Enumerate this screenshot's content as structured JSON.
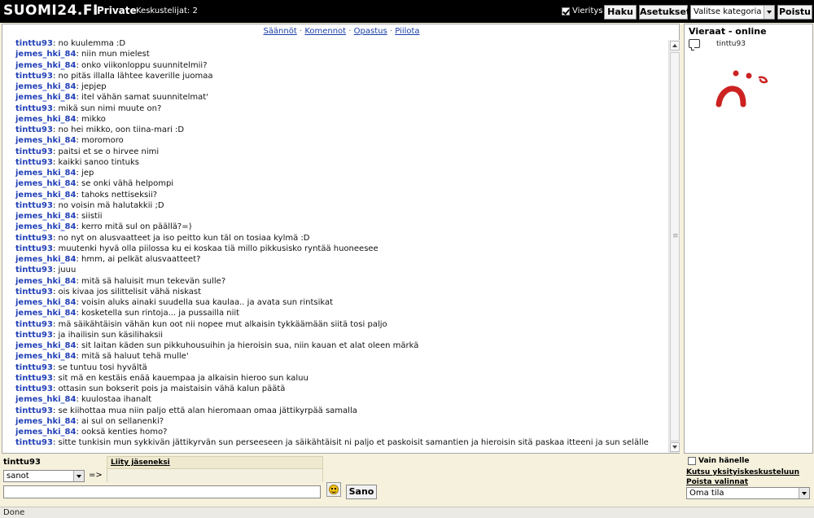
{
  "header": {
    "logo": "SUOMI24.FI",
    "room": "Private",
    "users_label": "Keskustelijat: 2",
    "scroll_label": "Vieritys",
    "search_btn": "Haku",
    "settings_btn": "Asetukset",
    "category_select": "Valitse kategoria",
    "leave_btn": "Poistu"
  },
  "chat_links": {
    "rules": "Säännöt",
    "commands": "Komennot",
    "help": "Opastus",
    "hide": "Piilota"
  },
  "messages": [
    {
      "nick": "tinttu93",
      "text": "no kuulemma :D"
    },
    {
      "nick": "jemes_hki_84",
      "text": "niin mun mielest"
    },
    {
      "nick": "jemes_hki_84",
      "text": "onko viikonloppu suunnitelmii?"
    },
    {
      "nick": "tinttu93",
      "text": "no pitäs illalla lähtee kaverille juomaa"
    },
    {
      "nick": "jemes_hki_84",
      "text": "jepjep"
    },
    {
      "nick": "jemes_hki_84",
      "text": "itel vähän samat suunnitelmat'"
    },
    {
      "nick": "tinttu93",
      "text": "mikä sun nimi muute on?"
    },
    {
      "nick": "jemes_hki_84",
      "text": "mikko"
    },
    {
      "nick": "tinttu93",
      "text": "no hei mikko, oon tiina-mari :D"
    },
    {
      "nick": "jemes_hki_84",
      "text": "moromoro"
    },
    {
      "nick": "tinttu93",
      "text": "paitsi et se o hirvee nimi"
    },
    {
      "nick": "tinttu93",
      "text": "kaikki sanoo tintuks"
    },
    {
      "nick": "jemes_hki_84",
      "text": "jep"
    },
    {
      "nick": "jemes_hki_84",
      "text": "se onki vähä helpompi"
    },
    {
      "nick": "jemes_hki_84",
      "text": "tahoks nettiseksii?"
    },
    {
      "nick": "tinttu93",
      "text": "no voisin mä halutakkii ;D"
    },
    {
      "nick": "jemes_hki_84",
      "text": "siistii"
    },
    {
      "nick": "jemes_hki_84",
      "text": "kerro mitä sul on päällä?=)"
    },
    {
      "nick": "tinttu93",
      "text": "no nyt on alusvaatteet ja iso peitto kun täl on tosiaa kylmä :D"
    },
    {
      "nick": "tinttu93",
      "text": "muutenki hyvä olla piilossa ku ei koskaa tiä millo pikkusisko ryntää huoneesee"
    },
    {
      "nick": "jemes_hki_84",
      "text": "hmm, ai pelkät alusvaatteet?"
    },
    {
      "nick": "tinttu93",
      "text": "juuu"
    },
    {
      "nick": "jemes_hki_84",
      "text": "mitä sä haluisit mun tekevän sulle?"
    },
    {
      "nick": "tinttu93",
      "text": "ois kivaa jos silittelisit vähä niskast"
    },
    {
      "nick": "jemes_hki_84",
      "text": "voisin aluks ainaki suudella sua kaulaa.. ja avata sun rintsikat"
    },
    {
      "nick": "jemes_hki_84",
      "text": "kosketella sun rintoja... ja pussailla niit"
    },
    {
      "nick": "tinttu93",
      "text": "mä säikähtäisin vähän kun oot nii nopee mut alkaisin tykkäämään siitä tosi paljo"
    },
    {
      "nick": "tinttu93",
      "text": "ja ihailisin sun käsilihaksii"
    },
    {
      "nick": "jemes_hki_84",
      "text": "sit laitan käden sun pikkuhousuihin ja hieroisin sua, niin kauan et alat oleen märkä"
    },
    {
      "nick": "jemes_hki_84",
      "text": "mitä sä haluut tehä mulle'"
    },
    {
      "nick": "tinttu93",
      "text": "se tuntuu tosi hyvältä"
    },
    {
      "nick": "tinttu93",
      "text": "sit mä en kestäis enää kauempaa ja alkaisin hieroo sun kaluu"
    },
    {
      "nick": "tinttu93",
      "text": "ottasin sun bokserit pois ja maistaisin vähä kalun päätä"
    },
    {
      "nick": "jemes_hki_84",
      "text": "kuulostaa ihanalt"
    },
    {
      "nick": "tinttu93",
      "text": "se kiihottaa mua niin paljo että alan hieromaan omaa jättikyrpää samalla"
    },
    {
      "nick": "jemes_hki_84",
      "text": "ai sul on sellanenki?"
    },
    {
      "nick": "jemes_hki_84",
      "text": "ooksä kenties homo?"
    },
    {
      "nick": "tinttu93",
      "text": "sitte tunkisin mun sykkivän jättikyrvän sun perseeseen ja säikähtäisit ni paljo et paskoisit samantien ja hieroisin sitä paskaa itteeni ja sun selälle"
    }
  ],
  "users_panel": {
    "title": "Vieraat - online",
    "users": [
      "tinttu93"
    ]
  },
  "input_area": {
    "my_nick": "tinttu93",
    "verb": "sanot",
    "arrow": "=>",
    "join_link": "Liity jäseneksi",
    "message_value": "",
    "send_btn": "Sano"
  },
  "right_controls": {
    "only_him": "Vain hänelle",
    "invite": "Kutsu yksityiskeskusteluun",
    "clear": "Poista valinnat",
    "room_select": "Oma tila"
  },
  "status": {
    "text": "Done"
  },
  "colors": {
    "nick": "#2342b8",
    "topbar": "#000000",
    "background": "#f5f1dc",
    "sad_face": "#cc2222"
  }
}
